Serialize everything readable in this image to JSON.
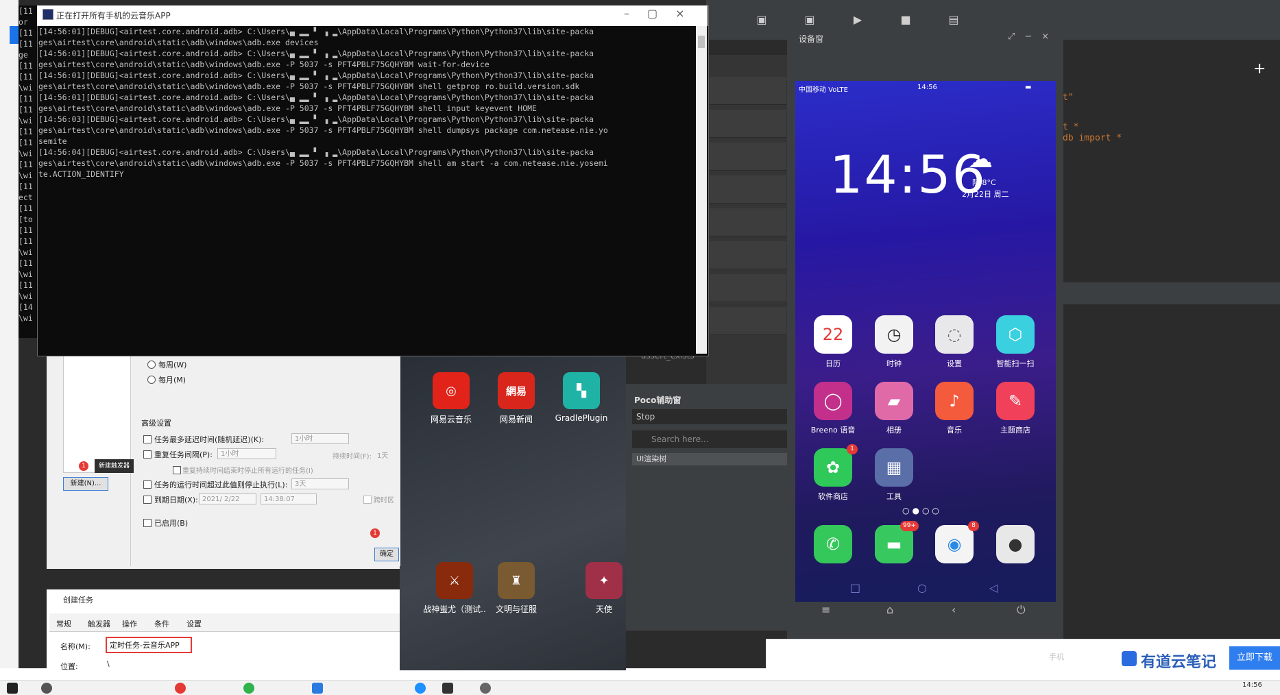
{
  "cmd": {
    "title": "正在打开所有手机的云音乐APP",
    "back_lines": "[11\nor \n[11\n[11\nge \n[11\n[11\n\\wi\n[11\n[11\n\\wi\n[11\n[11\n\\wi\n[11\n\\wi\n[11\nect\n[11\n[to\n[11\n[11\n\\wi\n[11\n\\wi\n[11\n\\wi\n[14\n\\wi",
    "lines": "[14:56:01][DEBUG]<airtest.core.android.adb> C:\\Users\\▄ ▂▂ ▘ ▗ ▂\\AppData\\Local\\Programs\\Python\\Python37\\lib\\site-packa\nges\\airtest\\core\\android\\static\\adb\\windows\\adb.exe devices\n[14:56:01][DEBUG]<airtest.core.android.adb> C:\\Users\\▄ ▂▂ ▘ ▗ ▂\\AppData\\Local\\Programs\\Python\\Python37\\lib\\site-packa\nges\\airtest\\core\\android\\static\\adb\\windows\\adb.exe -P 5037 -s PFT4PBLF75GQHYBM wait-for-device\n[14:56:01][DEBUG]<airtest.core.android.adb> C:\\Users\\▄ ▂▂ ▘ ▗ ▂\\AppData\\Local\\Programs\\Python\\Python37\\lib\\site-packa\nges\\airtest\\core\\android\\static\\adb\\windows\\adb.exe -P 5037 -s PFT4PBLF75GQHYBM shell getprop ro.build.version.sdk\n[14:56:01][DEBUG]<airtest.core.android.adb> C:\\Users\\▄ ▂▂ ▘ ▗ ▂\\AppData\\Local\\Programs\\Python\\Python37\\lib\\site-packa\nges\\airtest\\core\\android\\static\\adb\\windows\\adb.exe -P 5037 -s PFT4PBLF75GQHYBM shell input keyevent HOME\n[14:56:03][DEBUG]<airtest.core.android.adb> C:\\Users\\▄ ▂▂ ▘ ▗ ▂\\AppData\\Local\\Programs\\Python\\Python37\\lib\\site-packa\nges\\airtest\\core\\android\\static\\adb\\windows\\adb.exe -P 5037 -s PFT4PBLF75GQHYBM shell dumpsys package com.netease.nie.yo\nsemite\n[14:56:04][DEBUG]<airtest.core.android.adb> C:\\Users\\▄ ▂▂ ▘ ▗ ▂\\AppData\\Local\\Programs\\Python\\Python37\\lib\\site-packa\nges\\airtest\\core\\android\\static\\adb\\windows\\adb.exe -P 5037 -s PFT4PBLF75GQHYBM shell am start -a com.netease.nie.yosemi\nte.ACTION_IDENTIFY"
  },
  "ide": {
    "code_line1": "t\"",
    "code_line2": "t *",
    "code_line3": "db import *"
  },
  "device": {
    "title": "设备窗",
    "status_left": "中国移动 VoLTE",
    "status_time": "14:56",
    "clock": "14:56",
    "weather_temp": "阴 8°C",
    "weather_date": "2月22日 周二",
    "apps": [
      {
        "label": "日历",
        "glyph": "22",
        "color": "#ffffff",
        "fg": "#e53935"
      },
      {
        "label": "时钟",
        "glyph": "◷",
        "color": "#f2f2f2",
        "fg": "#222"
      },
      {
        "label": "设置",
        "glyph": "◌",
        "color": "#e8e8ea",
        "fg": "#666"
      },
      {
        "label": "智能扫一扫",
        "glyph": "⬡",
        "color": "#3ad0e0",
        "fg": "#fff"
      },
      {
        "label": "Breeno 语音",
        "glyph": "◯",
        "color": "#c2308c",
        "fg": "#fff"
      },
      {
        "label": "相册",
        "glyph": "▰",
        "color": "#e06aa8",
        "fg": "#fff"
      },
      {
        "label": "音乐",
        "glyph": "♪",
        "color": "#f45a3c",
        "fg": "#fff"
      },
      {
        "label": "主题商店",
        "glyph": "✎",
        "color": "#f0405a",
        "fg": "#fff"
      },
      {
        "label": "软件商店",
        "glyph": "✿",
        "color": "#2fc95a",
        "fg": "#fff",
        "badge": "1"
      },
      {
        "label": "工具",
        "glyph": "▦",
        "color": "#5a6fa8",
        "fg": "#fff"
      }
    ],
    "dock": [
      {
        "glyph": "✆",
        "color": "#34c759",
        "fg": "#fff"
      },
      {
        "glyph": "▬",
        "color": "#37c95f",
        "fg": "#fff",
        "badge": "99+"
      },
      {
        "glyph": "◉",
        "color": "#f4f4f4",
        "fg": "#2a8be6",
        "badge": "8"
      },
      {
        "glyph": "●",
        "color": "#e8e8e8",
        "fg": "#333"
      }
    ],
    "page_dots": "○●○○",
    "phone_nav": [
      "□",
      "○",
      "◁"
    ],
    "device_nav": [
      "≡",
      "⌂",
      "‹",
      "⏻"
    ]
  },
  "poco": {
    "assert_label": "assert_exists",
    "title": "Poco辅助窗",
    "stop": "Stop",
    "search_placeholder": "Search here...",
    "tree": "UI渲染树"
  },
  "desktop": {
    "apps": [
      {
        "label": "网易云音乐",
        "glyph": "◎",
        "color": "#e2231a"
      },
      {
        "label": "网易新闻",
        "glyph": "網易",
        "color": "#d8261c"
      },
      {
        "label": "GradlePlugin",
        "glyph": "▚",
        "color": "#1fb3a5"
      },
      {
        "label": "战神蚩尤（测试..",
        "glyph": "⚔",
        "color": "#8a2a0c"
      },
      {
        "label": "文明与征服",
        "glyph": "♜",
        "color": "#7a5a30"
      },
      {
        "label": "天使",
        "glyph": "✦",
        "color": "#a03048"
      }
    ]
  },
  "task": {
    "weekly": "每周(W)",
    "monthly": "每月(M)",
    "advanced": "高级设置",
    "delay_label": "任务最多延迟时间(随机延迟)(K):",
    "delay_value": "1小时",
    "repeat_label": "重复任务间隔(P):",
    "repeat_value": "1小时",
    "duration_label": "持续时间(F):",
    "duration_value": "1天",
    "stop_all_label": "重复持续时间结束时停止所有运行的任务(I)",
    "stop_if_label": "任务的运行时间超过此值则停止执行(L):",
    "stop_if_value": "3天",
    "expire_label": "到期日期(X):",
    "expire_date": "2021/ 2/22",
    "expire_time": "14:38:07",
    "sync_label": "跨时区",
    "enabled_label": "已启用(B)",
    "new_button": "新建(N)...",
    "new_trigger_tip": "新建触发器",
    "confirm_button": "确定",
    "badge_num": "1"
  },
  "create": {
    "title": "创建任务",
    "tabs": [
      "常规",
      "触发器",
      "操作",
      "条件",
      "设置"
    ],
    "name_label": "名称(M):",
    "name_value": "定时任务-云音乐APP",
    "pos_label": "位置:",
    "pos_value": "\\"
  },
  "youdao": {
    "logo": "有道云笔记",
    "button": "立即下载",
    "faded": "手机"
  },
  "taskbar": {
    "time": "14:56"
  }
}
